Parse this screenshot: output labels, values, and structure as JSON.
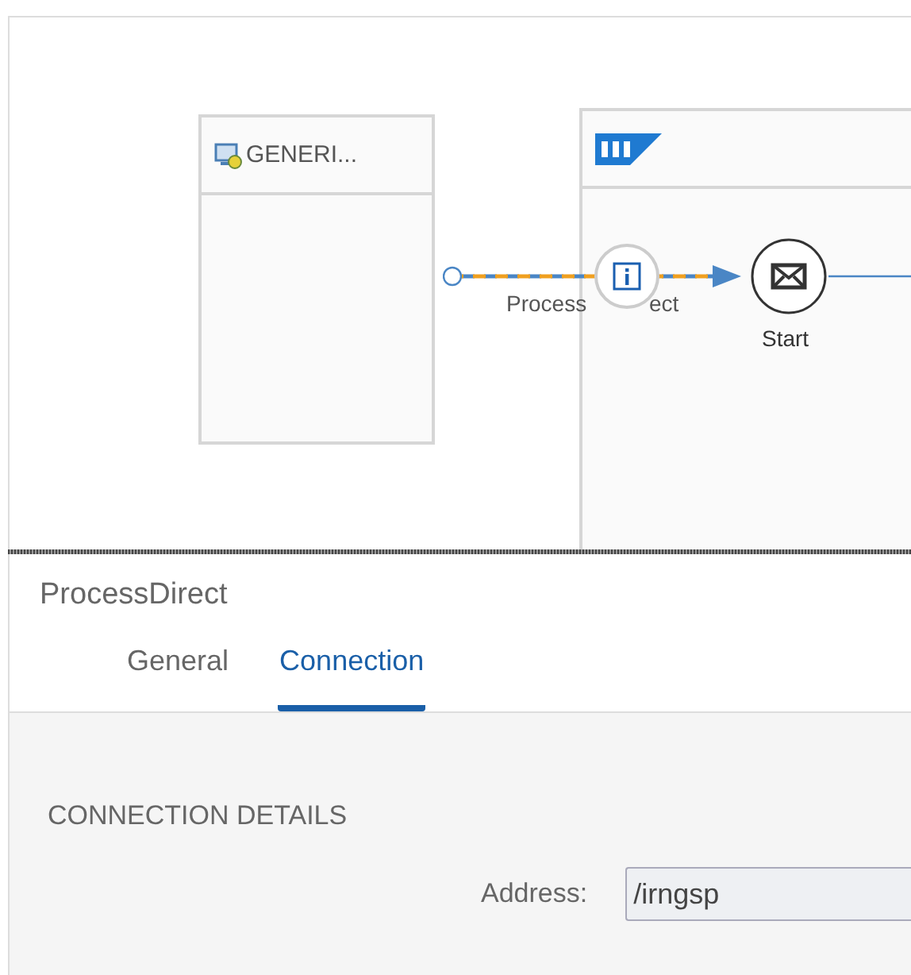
{
  "diagram": {
    "sender": {
      "title": "GENERI..."
    },
    "connection": {
      "label_before": "Process",
      "label_after": "ect"
    },
    "start_event": {
      "label": "Start"
    }
  },
  "panel": {
    "title": "ProcessDirect",
    "tabs": [
      {
        "label": "General",
        "selected": false
      },
      {
        "label": "Connection",
        "selected": true
      }
    ],
    "section": {
      "heading": "CONNECTION DETAILS",
      "fields": [
        {
          "label": "Address:",
          "value": "/irngsp"
        }
      ]
    }
  }
}
